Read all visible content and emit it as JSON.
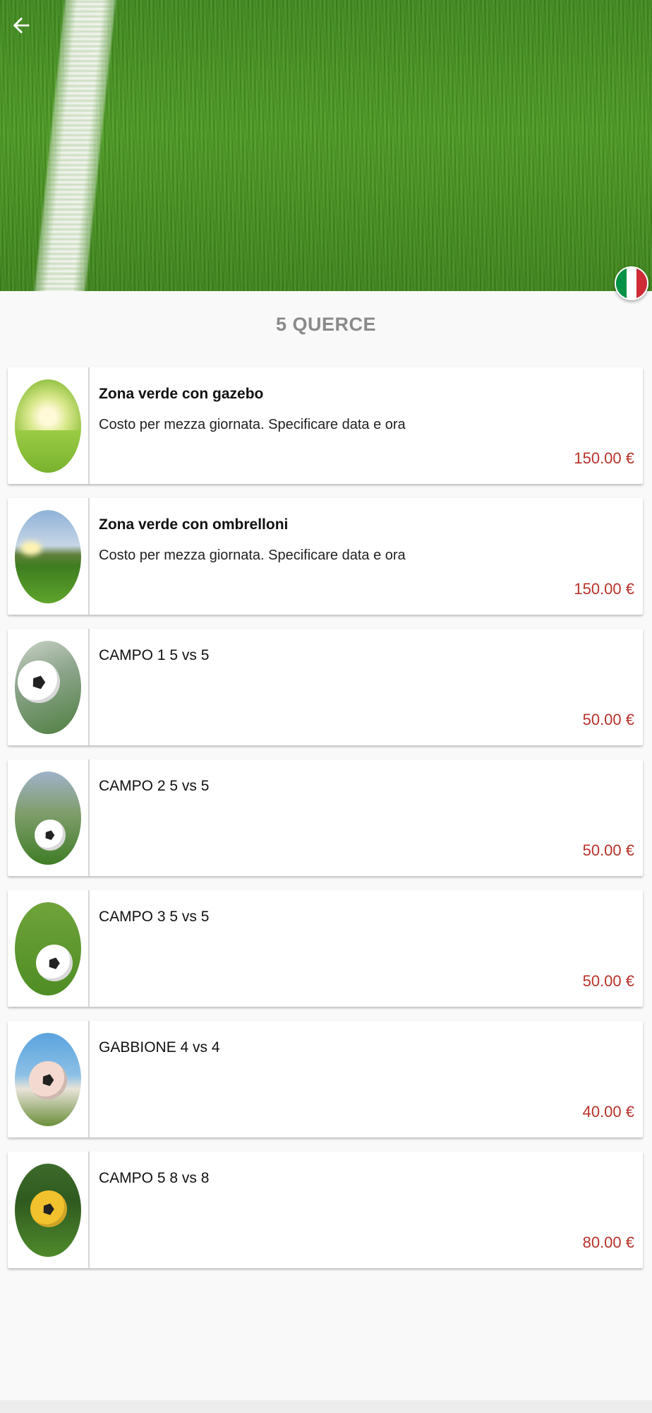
{
  "header": {
    "back_icon": "arrow-left-icon",
    "language_flag": "italy-flag-icon",
    "flag_colors": [
      "#009246",
      "#ffffff",
      "#ce2b37"
    ]
  },
  "page": {
    "title": "5 QUERCE"
  },
  "colors": {
    "price": "#b8322a",
    "title_gray": "#8a8a8a"
  },
  "items": [
    {
      "title": "Zona verde con gazebo",
      "description": "Costo per mezza giornata. Specificare data e ora",
      "price": "150.00 €",
      "image": "green-park-image"
    },
    {
      "title": "Zona verde con ombrelloni",
      "description": "Costo per mezza giornata. Specificare data e ora",
      "price": "150.00 €",
      "image": "green-field-sunset-image"
    },
    {
      "title": "CAMPO 1 5 vs 5",
      "description": "",
      "price": "50.00 €",
      "image": "soccer-ball-goal-image"
    },
    {
      "title": "CAMPO 2 5 vs 5",
      "description": "",
      "price": "50.00 €",
      "image": "soccer-ball-field-image"
    },
    {
      "title": "CAMPO 3 5 vs 5",
      "description": "",
      "price": "50.00 €",
      "image": "soccer-boots-ball-image"
    },
    {
      "title": "GABBIONE 4 vs 4",
      "description": "",
      "price": "40.00 €",
      "image": "goalkeeper-gloves-image"
    },
    {
      "title": "CAMPO 5 8 vs 8",
      "description": "",
      "price": "80.00 €",
      "image": "hands-holding-ball-image"
    }
  ]
}
